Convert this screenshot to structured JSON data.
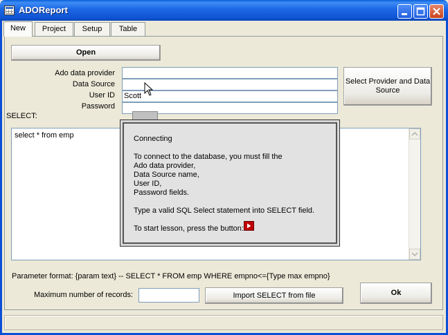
{
  "window": {
    "title": "ADOReport",
    "minimize_icon": "minimize-icon",
    "maximize_icon": "maximize-icon",
    "close_icon": "close-icon"
  },
  "tabs": [
    {
      "label": "New",
      "active": true
    },
    {
      "label": "Project"
    },
    {
      "label": "Setup"
    },
    {
      "label": "Table"
    }
  ],
  "form": {
    "open_label": "Open",
    "ado_provider_label": "Ado data provider",
    "ado_provider_value": "",
    "data_source_label": "Data Source",
    "data_source_value": "",
    "user_id_label": "User ID",
    "user_id_value": "Scott",
    "password_label": "Password",
    "password_value": "",
    "select_provider_label": "Select Provider and Data Source",
    "select_label": "SELECT:",
    "select_value": "select * from emp",
    "param_format": "Parameter format: {param text}  --  SELECT * FROM emp WHERE empno<={Type max empno}",
    "max_records_label": "Maximum number of records:",
    "max_records_value": "",
    "import_label": "Import SELECT from file",
    "ok_label": "Ok"
  },
  "popup": {
    "title": "Connecting",
    "line1": "To connect to the database, you must fill the",
    "line2": "Ado data provider,",
    "line3": "Data Source name,",
    "line4": "User ID,",
    "line5": "Password fields.",
    "line6": "Type a valid SQL Select statement into SELECT field.",
    "line7": "To start lesson, press the button:",
    "play_icon": "play-icon"
  },
  "colors": {
    "titlebar": "#0a5fd8",
    "close": "#c8441c",
    "play": "#c00000"
  }
}
